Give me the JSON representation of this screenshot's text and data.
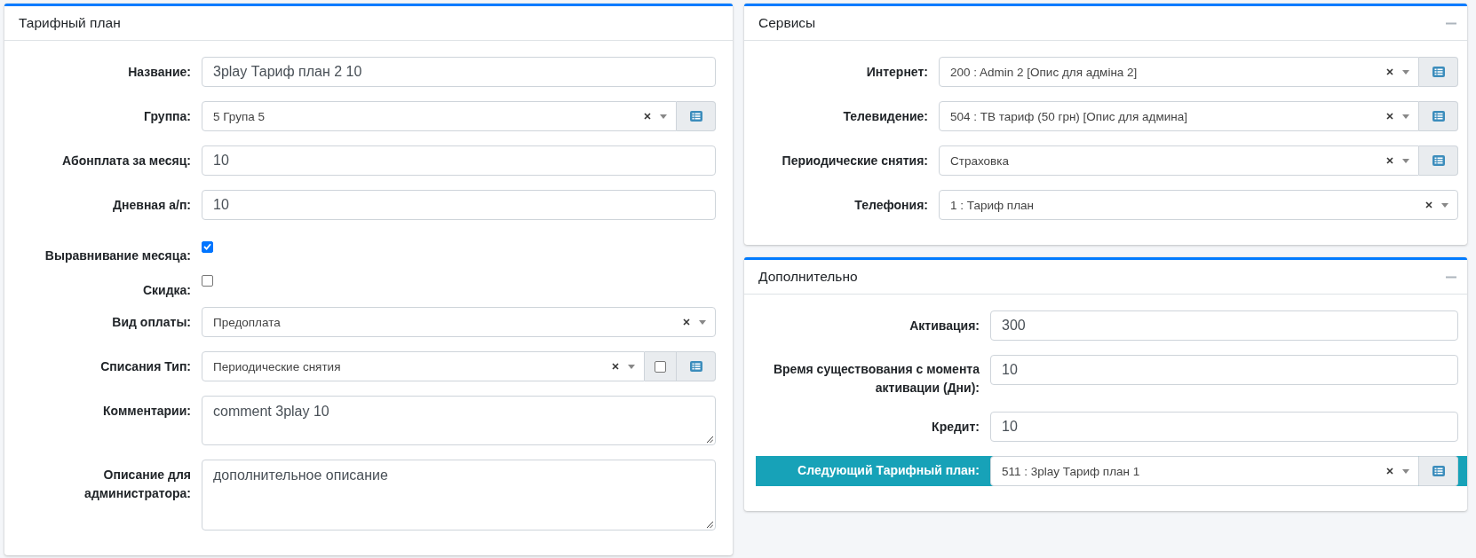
{
  "cards": [
    {
      "title": "Тарифный план",
      "collapsible": false,
      "fields": [
        {
          "kind": "text",
          "label": "Название:",
          "value": "3play Тариф план 2 10"
        },
        {
          "kind": "select",
          "label": "Группа:",
          "value": "5 Група 5",
          "addons": [
            {
              "kind": "list"
            }
          ]
        },
        {
          "kind": "text",
          "label": "Абонплата за месяц:",
          "value": "10"
        },
        {
          "kind": "text",
          "label": "Дневная а/п:",
          "value": "10"
        },
        {
          "kind": "checkbox",
          "label": "Выравнивание месяца:",
          "checked": true
        },
        {
          "kind": "checkbox",
          "label": "Скидка:",
          "checked": false
        },
        {
          "kind": "select",
          "label": "Вид оплаты:",
          "value": "Предоплата"
        },
        {
          "kind": "select",
          "label": "Списания Тип:",
          "value": "Периодические снятия",
          "addons": [
            {
              "kind": "checkbox",
              "checked": false
            },
            {
              "kind": "list"
            }
          ]
        },
        {
          "kind": "textarea",
          "label": "Комментарии:",
          "value": "comment 3play 10"
        },
        {
          "kind": "textarea",
          "label": "Описание для администратора:",
          "value": "дополнительное описание"
        }
      ]
    },
    {
      "title": "Сервисы",
      "collapsible": true,
      "fields": [
        {
          "kind": "select",
          "label": "Интернет:",
          "value": "200 : Admin 2 [Опис для адміна 2]",
          "addons": [
            {
              "kind": "list"
            }
          ]
        },
        {
          "kind": "select",
          "label": "Телевидение:",
          "value": "504 : ТВ тариф (50 грн) [Опис для админа]",
          "addons": [
            {
              "kind": "list"
            }
          ]
        },
        {
          "kind": "select",
          "label": "Периодические снятия:",
          "value": "Страховка",
          "addons": [
            {
              "kind": "list"
            }
          ]
        },
        {
          "kind": "select",
          "label": "Телефония:",
          "value": "1 : Тариф план"
        }
      ]
    },
    {
      "title": "Дополнительно",
      "collapsible": true,
      "fields": [
        {
          "kind": "text",
          "label": "Активация:",
          "value": "300",
          "highlighted": false
        },
        {
          "kind": "text",
          "label": "Время существования с момента активации (Дни):",
          "value": "10",
          "highlighted": false
        },
        {
          "kind": "text",
          "label": "Кредит:",
          "value": "10",
          "highlighted": false
        },
        {
          "kind": "select",
          "label": "Следующий Тарифный план:",
          "value": "511 : 3play Тариф план 1",
          "addons": [
            {
              "kind": "list"
            }
          ],
          "highlighted": true
        }
      ]
    }
  ]
}
